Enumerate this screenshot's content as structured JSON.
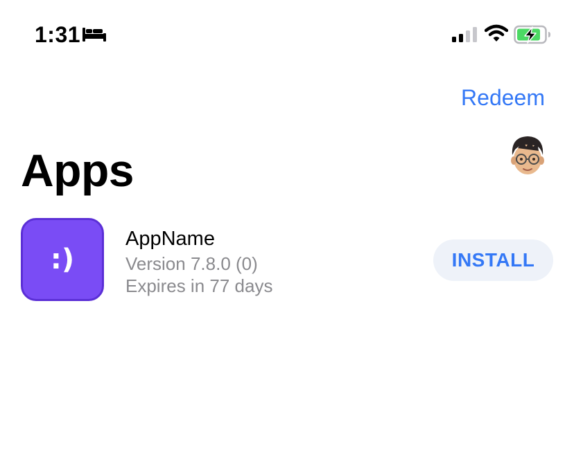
{
  "status_bar": {
    "time": "1:31",
    "focus_icon": "bed-icon",
    "signal_icon": "cellular-signal-icon",
    "wifi_icon": "wifi-icon",
    "battery_icon": "battery-charging-icon",
    "battery_color": "#4cd964"
  },
  "nav": {
    "redeem_label": "Redeem"
  },
  "page": {
    "title": "Apps",
    "avatar_icon": "memoji-avatar-icon"
  },
  "apps": [
    {
      "name": "AppName",
      "version": "Version 7.8.0 (0)",
      "expiry": "Expires in 77 days",
      "icon_glyph": ":)",
      "icon_color": "#7a4cf5",
      "action_label": "INSTALL"
    }
  ],
  "colors": {
    "accent": "#3478f6",
    "secondary_text": "#8a8a8e",
    "button_bg": "#eef2f9"
  }
}
